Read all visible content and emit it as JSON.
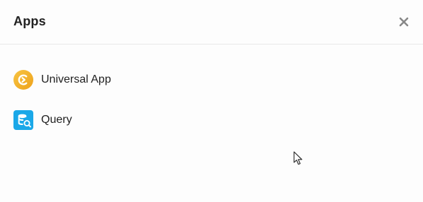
{
  "header": {
    "title": "Apps",
    "close_icon": "close-icon"
  },
  "apps": [
    {
      "label": "Universal App",
      "icon": "universal-app-icon",
      "color": "#f0ad22"
    },
    {
      "label": "Query",
      "icon": "query-icon",
      "color": "#1aa8e8"
    }
  ]
}
